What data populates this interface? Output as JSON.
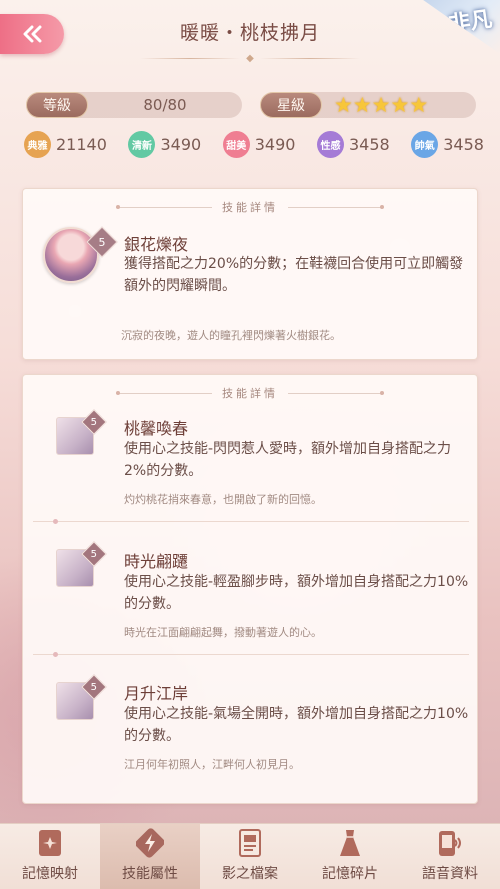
{
  "header": {
    "title": "暖暖・桃枝拂月",
    "corner_badge": "非凡"
  },
  "level": {
    "label": "等級",
    "value": "80/80"
  },
  "stars": {
    "label": "星級",
    "count": 5,
    "glyph": "★"
  },
  "stats": [
    {
      "icon_text": "典雅",
      "value": "21140",
      "color": "#e6a352"
    },
    {
      "icon_text": "清新",
      "value": "3490",
      "color": "#62c9a3"
    },
    {
      "icon_text": "甜美",
      "value": "3490",
      "color": "#ef7e92"
    },
    {
      "icon_text": "性感",
      "value": "3458",
      "color": "#a57bd6"
    },
    {
      "icon_text": "帥氣",
      "value": "3458",
      "color": "#6aa6e6"
    }
  ],
  "main_skill": {
    "header": "技能詳情",
    "level": "5",
    "name": "銀花爍夜",
    "desc": "獲得搭配之力20%的分數；在鞋襪回合使用可立即觸發額外的閃耀瞬間。",
    "flavor": "沉寂的夜晚，遊人的瞳孔裡閃爍著火樹銀花。"
  },
  "sub_skills": {
    "header": "技能詳情",
    "items": [
      {
        "level": "5",
        "name": "桃馨喚春",
        "desc": "使用心之技能-閃閃惹人愛時，額外增加自身搭配之力2%的分數。",
        "flavor": "灼灼桃花捎來春意，也開啟了新的回憶。"
      },
      {
        "level": "5",
        "name": "時光翩躚",
        "desc": "使用心之技能-輕盈腳步時，額外增加自身搭配之力10%的分數。",
        "flavor": "時光在江面翩翩起舞，撥動著遊人的心。"
      },
      {
        "level": "5",
        "name": "月升江岸",
        "desc": "使用心之技能-氣場全開時，額外增加自身搭配之力10%的分數。",
        "flavor": "江月何年初照人，江畔何人初見月。"
      }
    ]
  },
  "bottom_nav": [
    {
      "label": "記憶映射",
      "icon": "memory-card-icon",
      "active": false
    },
    {
      "label": "技能屬性",
      "icon": "skill-lightning-icon",
      "active": true
    },
    {
      "label": "影之檔案",
      "icon": "document-icon",
      "active": false
    },
    {
      "label": "記憶碎片",
      "icon": "dress-icon",
      "active": false
    },
    {
      "label": "語音資料",
      "icon": "voice-phone-icon",
      "active": false
    }
  ]
}
